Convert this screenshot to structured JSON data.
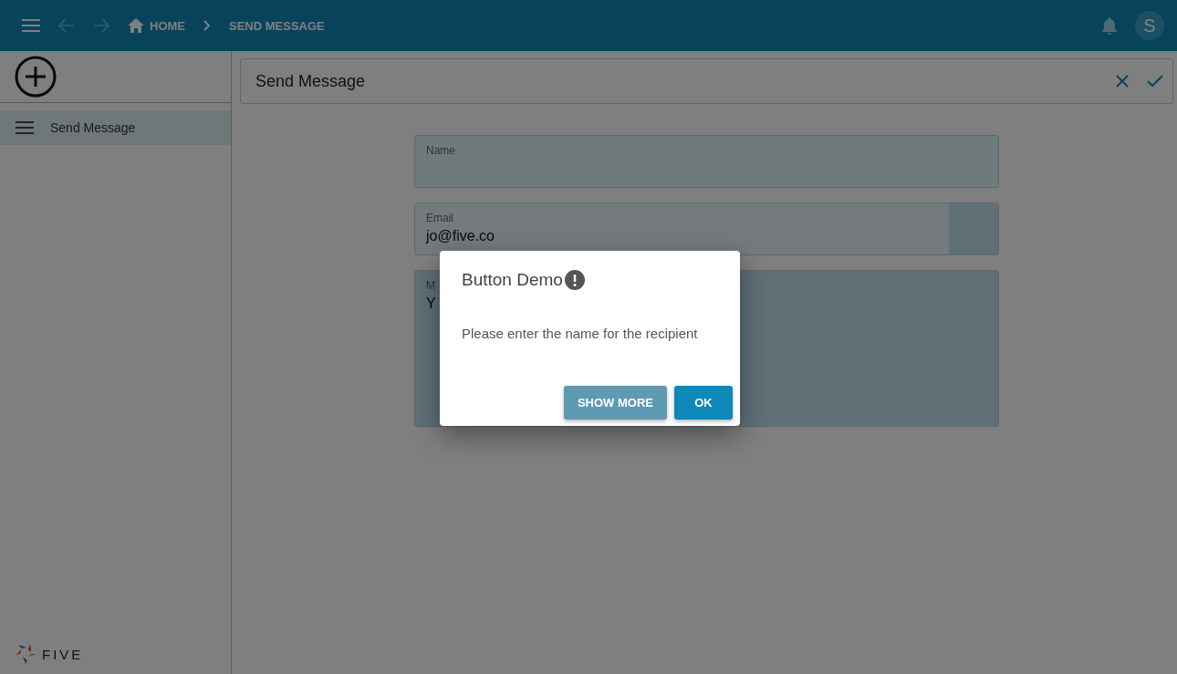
{
  "app_bar": {
    "breadcrumbs": [
      {
        "label": "HOME",
        "kind": "home"
      },
      {
        "label": "SEND MESSAGE",
        "kind": "page"
      }
    ],
    "avatar": "S"
  },
  "sidebar": {
    "items": [
      {
        "label": "Send Message",
        "selected": true
      }
    ],
    "logo": "FIVE"
  },
  "form": {
    "title": "Send Message",
    "fields": [
      {
        "label": "Name",
        "kind": "text"
      },
      {
        "label": "Email",
        "value": "jo@five.co",
        "kind": "email"
      },
      {
        "label": "M",
        "value": "Y",
        "kind": "textarea"
      }
    ]
  },
  "dialog": {
    "title": "Button Demo",
    "message": "Please enter the name for the recipient",
    "buttons": [
      {
        "label": "SHOW MORE",
        "kind": "secondary"
      },
      {
        "label": "OK",
        "kind": "primary"
      }
    ]
  }
}
